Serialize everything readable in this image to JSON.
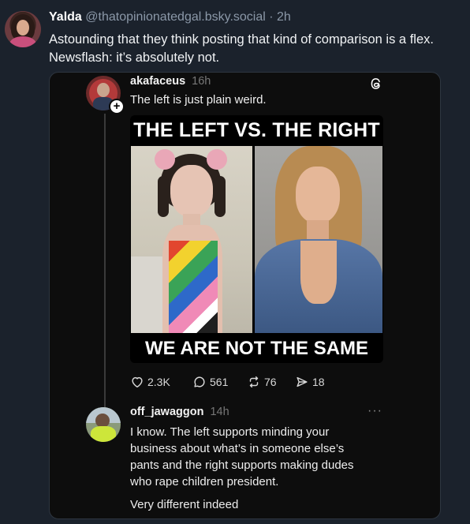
{
  "post": {
    "author_name": "Yalda",
    "author_handle": "@thatopinionatedgal.bsky.social",
    "separator": "·",
    "time": "2h",
    "text_line1": "Astounding that they think posting that kind of comparison is a flex.",
    "text_line2": "Newsflash: it’s absolutely not."
  },
  "embed": {
    "reply1": {
      "username": "akafaceus",
      "time": "16h",
      "text": "The left is just plain weird.",
      "plus_label": "+",
      "meme_top": "THE LEFT VS. THE RIGHT",
      "meme_bottom": "WE ARE NOT THE SAME",
      "stats": {
        "likes": "2.3K",
        "replies": "561",
        "reposts": "76",
        "shares": "18"
      }
    },
    "reply2": {
      "username": "off_jawaggon",
      "time": "14h",
      "more_label": "···",
      "text_line1": "I know. The left supports minding your",
      "text_line2": "business about what’s in someone else’s",
      "text_line3": "pants and the right supports making dudes",
      "text_line4": "who rape children president.",
      "text_extra": "Very different indeed"
    }
  },
  "icons": {
    "like": "heart-icon",
    "reply": "comment-icon",
    "repost": "repost-icon",
    "share": "send-icon",
    "platform": "threads-icon"
  },
  "colors": {
    "background": "#1b222c",
    "embed_background": "#0d0d0d",
    "handle_grey": "#8b98a8"
  }
}
